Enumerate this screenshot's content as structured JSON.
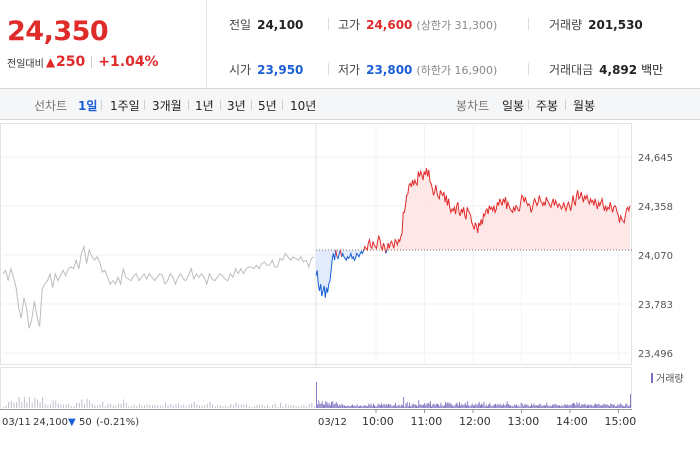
{
  "summary": {
    "current_price": "24,350",
    "change_label": "전일대비",
    "change_arrow": "▲",
    "change_value": "250",
    "change_rate": "+1.04%",
    "prev_close": {
      "label": "전일",
      "value": "24,100"
    },
    "high": {
      "label": "고가",
      "value": "24,600",
      "sub": "(상한가 31,300)"
    },
    "volume": {
      "label": "거래량",
      "value": "201,530"
    },
    "open": {
      "label": "시가",
      "value": "23,950"
    },
    "low": {
      "label": "저가",
      "value": "23,800",
      "sub": "(하한가 16,900)"
    },
    "amount": {
      "label": "거래대금",
      "value": "4,892",
      "unit": "백만"
    }
  },
  "tabs": {
    "line_chart_label": "선차트",
    "line_periods": [
      "1일",
      "1주일",
      "3개월",
      "1년",
      "3년",
      "5년",
      "10년"
    ],
    "active_period": "1일",
    "candle_chart_label": "봉차트",
    "candle_periods": [
      "일봉",
      "주봉",
      "월봉"
    ]
  },
  "colors": {
    "up": "#e02b2b",
    "down": "#1a5fd6",
    "prev_day_line": "#bdbdbd",
    "up_fill": "#fde3e3",
    "down_fill": "#dde8fb",
    "volume_bar": "#7a6fc0"
  },
  "chart_data": {
    "type": "line",
    "y_ticks": [
      "24,645",
      "24,358",
      "24,070",
      "23,783",
      "23,496"
    ],
    "ylim": [
      23496,
      24645
    ],
    "prev_close_value": 24100,
    "prev_day_footer": {
      "date": "03/11",
      "close": "24,100",
      "arrow": "▼",
      "change": "50",
      "rate": "(-0.21%)"
    },
    "today_date": "03/12",
    "x_ticks": [
      "10:00",
      "11:00",
      "12:00",
      "13:00",
      "14:00",
      "15:00"
    ],
    "volume_legend": "거래량",
    "series": [
      {
        "values": [
          23960,
          23980,
          23920,
          23990,
          23940,
          23880,
          23760,
          23700,
          23820,
          23760,
          23640,
          23690,
          23800,
          23710,
          23650,
          23870,
          23900,
          23920,
          23960,
          23880,
          23960,
          23920,
          23950,
          23980,
          23950,
          23990,
          24000,
          23990,
          24040,
          23990,
          24080,
          24120,
          24020,
          24100,
          24060,
          24040,
          24060,
          24030,
          23970,
          23980,
          23940,
          23900,
          23920,
          23900,
          23940,
          23900,
          23990,
          23940,
          23930,
          23920,
          23950,
          23960,
          23920,
          23940,
          23960,
          23930,
          23960,
          23940,
          23920,
          23940,
          23960,
          23950,
          23900,
          23920,
          23960,
          23940,
          23900,
          23940,
          23960,
          23930,
          23920,
          23950,
          23990,
          23930,
          23960,
          23940,
          23960,
          23940,
          23900,
          23960,
          23930,
          23920,
          23940,
          23960,
          23950,
          23930,
          23920,
          23960,
          23940,
          23990,
          23960,
          23990,
          23960,
          23990,
          24000,
          24000,
          23990,
          24010,
          23990,
          24020,
          24030,
          24010,
          24010,
          24040,
          24000,
          24000,
          24050,
          24040,
          24080,
          24060,
          24040,
          24060,
          24050,
          24040,
          24060,
          24030,
          24040,
          24000,
          24050,
          24060
        ]
      },
      {
        "values": [
          23950,
          23980,
          23900,
          23860,
          23900,
          23830,
          23860,
          23890,
          23820,
          23880,
          23850,
          23900,
          23920,
          23980,
          24050,
          24080,
          24040,
          24100,
          24060,
          24050,
          24080,
          24100,
          24060,
          24080,
          24060,
          24050,
          24040,
          24060,
          24050,
          24060,
          24080,
          24050,
          24060,
          24040,
          24050,
          24080,
          24070,
          24060,
          24080,
          24090,
          24080,
          24100,
          24120,
          24110,
          24100,
          24140,
          24160,
          24120,
          24110,
          24150,
          24130,
          24120,
          24110,
          24150,
          24180,
          24160,
          24120,
          24100,
          24140,
          24120,
          24080,
          24100,
          24140,
          24110,
          24140,
          24150,
          24130,
          24110,
          24160,
          24150,
          24130,
          24160,
          24150,
          24180,
          24200,
          24320,
          24320,
          24360,
          24420,
          24430,
          24480,
          24490,
          24470,
          24510,
          24480,
          24510,
          24490,
          24480,
          24560,
          24530,
          24560,
          24540,
          24510,
          24560,
          24540,
          24580,
          24530,
          24570,
          24500,
          24490,
          24460,
          24420,
          24440,
          24480,
          24440,
          24410,
          24400,
          24450,
          24430,
          24420,
          24440,
          24380,
          24420,
          24360,
          24400,
          24350,
          24320,
          24340,
          24330,
          24350,
          24310,
          24360,
          24380,
          24320,
          24300,
          24340,
          24320,
          24350,
          24300,
          24280,
          24350,
          24330,
          24320,
          24300,
          24260,
          24240,
          24220,
          24260,
          24240,
          24200,
          24260,
          24240,
          24280,
          24250,
          24310,
          24300,
          24330,
          24340,
          24310,
          24360,
          24340,
          24350,
          24330,
          24360,
          24320,
          24340,
          24380,
          24360,
          24400,
          24380,
          24360,
          24400,
          24380,
          24410,
          24340,
          24380,
          24360,
          24340,
          24330,
          24320,
          24350,
          24330,
          24360,
          24350,
          24330,
          24330,
          24380,
          24420,
          24410,
          24380,
          24410,
          24380,
          24360,
          24370,
          24360,
          24320,
          24340,
          24380,
          24400,
          24380,
          24360,
          24380,
          24420,
          24390,
          24380,
          24360,
          24380,
          24360,
          24410,
          24390,
          24380,
          24360,
          24350,
          24380,
          24400,
          24360,
          24390,
          24370,
          24350,
          24370,
          24360,
          24340,
          24350,
          24380,
          24350,
          24330,
          24360,
          24380,
          24360,
          24330,
          24370,
          24420,
          24380,
          24360,
          24420,
          24450,
          24400,
          24410,
          24440,
          24410,
          24380,
          24420,
          24400,
          24420,
          24390,
          24370,
          24400,
          24380,
          24390,
          24360,
          24400,
          24370,
          24340,
          24380,
          24360,
          24380,
          24400,
          24360,
          24330,
          24360,
          24330,
          24350,
          24340,
          24380,
          24350,
          24320,
          24350,
          24360,
          24350,
          24320,
          24300,
          24260,
          24300,
          24280,
          24270,
          24260,
          24300,
          24340,
          24350,
          24330,
          24360
        ]
      }
    ]
  }
}
